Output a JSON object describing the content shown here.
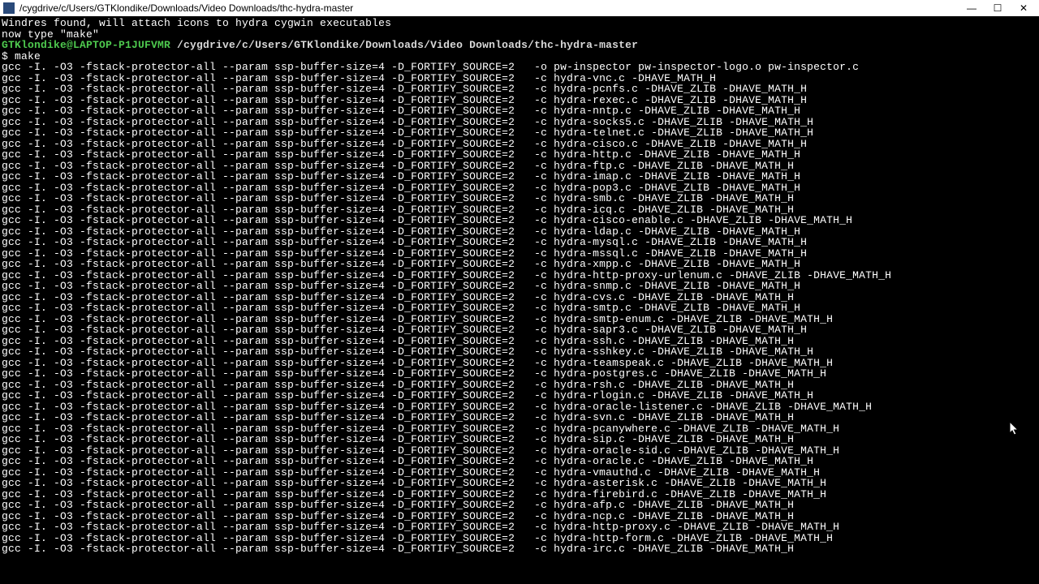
{
  "titlebar": {
    "title": "/cygdrive/c/Users/GTKlondike/Downloads/Video Downloads/thc-hydra-master"
  },
  "terminal": {
    "msg_windres": "Windres found, will attach icons to hydra cygwin executables",
    "msg_blank": "",
    "msg_make": "now type \"make\"",
    "prompt_user": "GTKlondike@LAPTOP-P1JUFVMR",
    "prompt_path": " /cygdrive/c/Users/GTKlondike/Downloads/Video Downloads/thc-hydra-master",
    "cmd": "$ make",
    "gcc_prefix": "gcc -I. -O3 -fstack-protector-all --param ssp-buffer-size=4 -D_FORTIFY_SOURCE=2   ",
    "line_pw": "-o pw-inspector pw-inspector-logo.o pw-inspector.c",
    "files": [
      "hydra-vnc.c -DHAVE_MATH_H",
      "hydra-pcnfs.c -DHAVE_ZLIB -DHAVE_MATH_H",
      "hydra-rexec.c -DHAVE_ZLIB -DHAVE_MATH_H",
      "hydra-nntp.c -DHAVE_ZLIB -DHAVE_MATH_H",
      "hydra-socks5.c -DHAVE_ZLIB -DHAVE_MATH_H",
      "hydra-telnet.c -DHAVE_ZLIB -DHAVE_MATH_H",
      "hydra-cisco.c -DHAVE_ZLIB -DHAVE_MATH_H",
      "hydra-http.c -DHAVE_ZLIB -DHAVE_MATH_H",
      "hydra-ftp.c -DHAVE_ZLIB -DHAVE_MATH_H",
      "hydra-imap.c -DHAVE_ZLIB -DHAVE_MATH_H",
      "hydra-pop3.c -DHAVE_ZLIB -DHAVE_MATH_H",
      "hydra-smb.c -DHAVE_ZLIB -DHAVE_MATH_H",
      "hydra-icq.c -DHAVE_ZLIB -DHAVE_MATH_H",
      "hydra-cisco-enable.c -DHAVE_ZLIB -DHAVE_MATH_H",
      "hydra-ldap.c -DHAVE_ZLIB -DHAVE_MATH_H",
      "hydra-mysql.c -DHAVE_ZLIB -DHAVE_MATH_H",
      "hydra-mssql.c -DHAVE_ZLIB -DHAVE_MATH_H",
      "hydra-xmpp.c -DHAVE_ZLIB -DHAVE_MATH_H",
      "hydra-http-proxy-urlenum.c -DHAVE_ZLIB -DHAVE_MATH_H",
      "hydra-snmp.c -DHAVE_ZLIB -DHAVE_MATH_H",
      "hydra-cvs.c -DHAVE_ZLIB -DHAVE_MATH_H",
      "hydra-smtp.c -DHAVE_ZLIB -DHAVE_MATH_H",
      "hydra-smtp-enum.c -DHAVE_ZLIB -DHAVE_MATH_H",
      "hydra-sapr3.c -DHAVE_ZLIB -DHAVE_MATH_H",
      "hydra-ssh.c -DHAVE_ZLIB -DHAVE_MATH_H",
      "hydra-sshkey.c -DHAVE_ZLIB -DHAVE_MATH_H",
      "hydra-teamspeak.c -DHAVE_ZLIB -DHAVE_MATH_H",
      "hydra-postgres.c -DHAVE_ZLIB -DHAVE_MATH_H",
      "hydra-rsh.c -DHAVE_ZLIB -DHAVE_MATH_H",
      "hydra-rlogin.c -DHAVE_ZLIB -DHAVE_MATH_H",
      "hydra-oracle-listener.c -DHAVE_ZLIB -DHAVE_MATH_H",
      "hydra-svn.c -DHAVE_ZLIB -DHAVE_MATH_H",
      "hydra-pcanywhere.c -DHAVE_ZLIB -DHAVE_MATH_H",
      "hydra-sip.c -DHAVE_ZLIB -DHAVE_MATH_H",
      "hydra-oracle-sid.c -DHAVE_ZLIB -DHAVE_MATH_H",
      "hydra-oracle.c -DHAVE_ZLIB -DHAVE_MATH_H",
      "hydra-vmauthd.c -DHAVE_ZLIB -DHAVE_MATH_H",
      "hydra-asterisk.c -DHAVE_ZLIB -DHAVE_MATH_H",
      "hydra-firebird.c -DHAVE_ZLIB -DHAVE_MATH_H",
      "hydra-afp.c -DHAVE_ZLIB -DHAVE_MATH_H",
      "hydra-ncp.c -DHAVE_ZLIB -DHAVE_MATH_H",
      "hydra-http-proxy.c -DHAVE_ZLIB -DHAVE_MATH_H",
      "hydra-http-form.c -DHAVE_ZLIB -DHAVE_MATH_H",
      "hydra-irc.c -DHAVE_ZLIB -DHAVE_MATH_H"
    ]
  }
}
